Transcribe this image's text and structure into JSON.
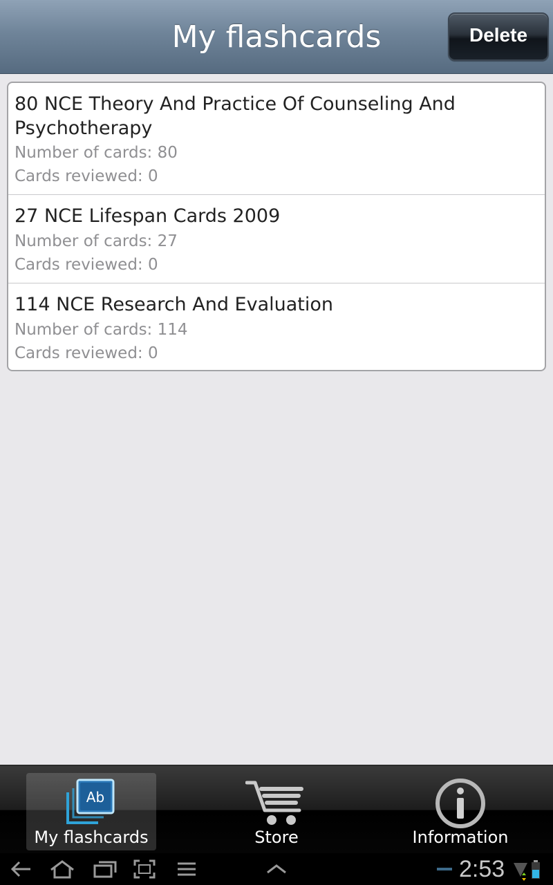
{
  "header": {
    "title": "My flashcards",
    "delete_label": "Delete"
  },
  "decks": [
    {
      "title": "80 NCE Theory And Practice Of Counseling And Psychotherapy",
      "cards": "Number of cards: 80",
      "reviewed": "Cards reviewed: 0"
    },
    {
      "title": "27 NCE Lifespan Cards 2009",
      "cards": "Number of cards: 27",
      "reviewed": "Cards reviewed: 0"
    },
    {
      "title": "114 NCE Research And Evaluation",
      "cards": "Number of cards: 114",
      "reviewed": "Cards reviewed: 0"
    }
  ],
  "tabs": [
    {
      "label": "My flashcards",
      "icon": "flashcards-ab-icon",
      "active": true
    },
    {
      "label": "Store",
      "icon": "cart-icon",
      "active": false
    },
    {
      "label": "Information",
      "icon": "info-icon",
      "active": false
    }
  ],
  "system_bar": {
    "time": "2:53",
    "icons": [
      "back-icon",
      "home-icon",
      "recent-apps-icon",
      "screenshot-icon",
      "menu-icon",
      "chevron-up-icon",
      "signal-icon",
      "battery-icon"
    ]
  },
  "colors": {
    "header_accent": "#6f8499",
    "icon_blue": "#2fa3d8",
    "page_background": "#e9e8eb"
  }
}
